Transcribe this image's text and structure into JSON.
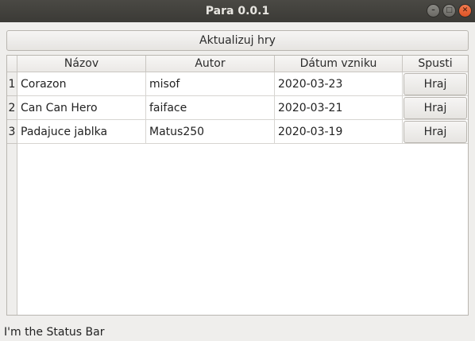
{
  "window": {
    "title": "Para 0.0.1",
    "minimize_glyph": "–",
    "maximize_glyph": "□",
    "close_glyph": "✕"
  },
  "toolbar": {
    "update_label": "Aktualizuj hry"
  },
  "table": {
    "columns": [
      "Názov",
      "Autor",
      "Dátum vzniku",
      "Spusti"
    ],
    "rows": [
      {
        "index": "1",
        "name": "Corazon",
        "author": "misof",
        "date": "2020-03-23",
        "action": "Hraj"
      },
      {
        "index": "2",
        "name": "Can Can Hero",
        "author": "faiface",
        "date": "2020-03-21",
        "action": "Hraj"
      },
      {
        "index": "3",
        "name": "Padajuce jablka",
        "author": "Matus250",
        "date": "2020-03-19",
        "action": "Hraj"
      }
    ]
  },
  "status_bar": {
    "text": "I'm the Status Bar"
  },
  "colors": {
    "titlebar": "#3b3a36",
    "window_bg": "#efeeec",
    "close_button": "#dd5326"
  }
}
